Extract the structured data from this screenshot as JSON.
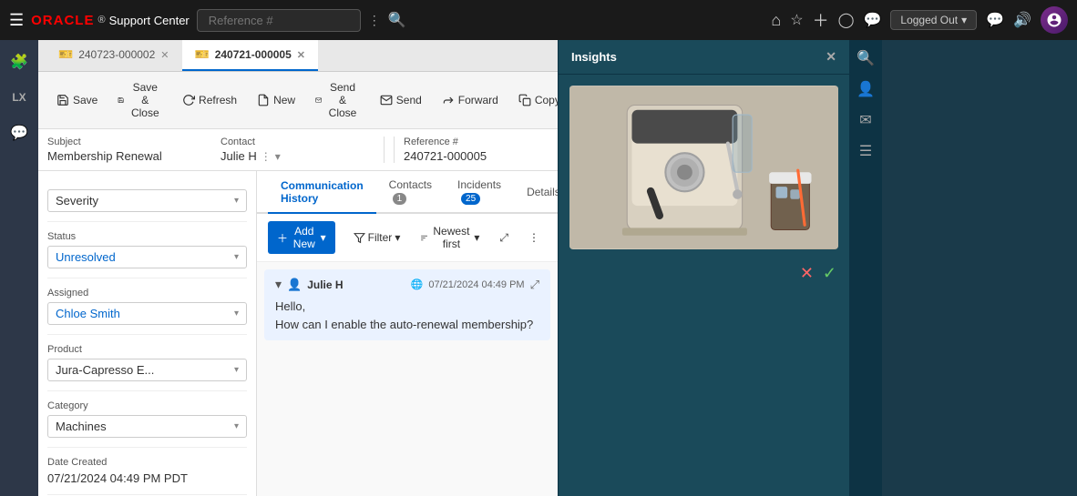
{
  "app": {
    "title": "Oracle Support Center",
    "logo_oracle": "ORACLE",
    "logo_text": "Support Center",
    "search_placeholder": "Reference #"
  },
  "nav": {
    "logged_out_label": "Logged Out",
    "chevron": "▾"
  },
  "tabs": [
    {
      "id": "tab1",
      "label": "240723-000002",
      "active": false
    },
    {
      "id": "tab2",
      "label": "240721-000005",
      "active": true
    }
  ],
  "toolbar": {
    "save_label": "Save",
    "save_close_label": "Save & Close",
    "refresh_label": "Refresh",
    "new_label": "New",
    "send_close_label": "Send & Close",
    "send_label": "Send",
    "forward_label": "Forward",
    "copy_label": "Copy"
  },
  "ticket": {
    "subject_label": "Subject",
    "subject_value": "Membership Renewal",
    "contact_label": "Contact",
    "contact_value": "Julie H",
    "ref_label": "Reference #",
    "ref_value": "240721-000005",
    "severity_label": "Severity",
    "severity_value": "",
    "status_label": "Status",
    "status_value": "Unresolved",
    "assigned_label": "Assigned",
    "assigned_value": "Chloe Smith",
    "product_label": "Product",
    "product_value": "Jura-Capresso E...",
    "category_label": "Category",
    "category_value": "Machines",
    "date_created_label": "Date Created",
    "date_created_value": "07/21/2024 04:49 PM PDT"
  },
  "comms_tabs": [
    {
      "label": "Communication History",
      "active": true,
      "badge": null
    },
    {
      "label": "Contacts",
      "active": false,
      "badge": "1"
    },
    {
      "label": "Incidents",
      "active": false,
      "badge": "25"
    },
    {
      "label": "Details",
      "active": false,
      "badge": null
    }
  ],
  "comm_toolbar": {
    "add_new_label": "Add New",
    "filter_label": "Filter",
    "sort_label": "Newest first",
    "expand_icon": "⤢",
    "more_icon": "⋮"
  },
  "messages": [
    {
      "sender": "Julie H",
      "timestamp": "07/21/2024 04:49 PM",
      "body_line1": "Hello,",
      "body_line2": "How can I enable the auto-renewal membership?"
    }
  ],
  "insights": {
    "title": "Insights",
    "close_icon": "✕",
    "check_icon": "✓"
  }
}
